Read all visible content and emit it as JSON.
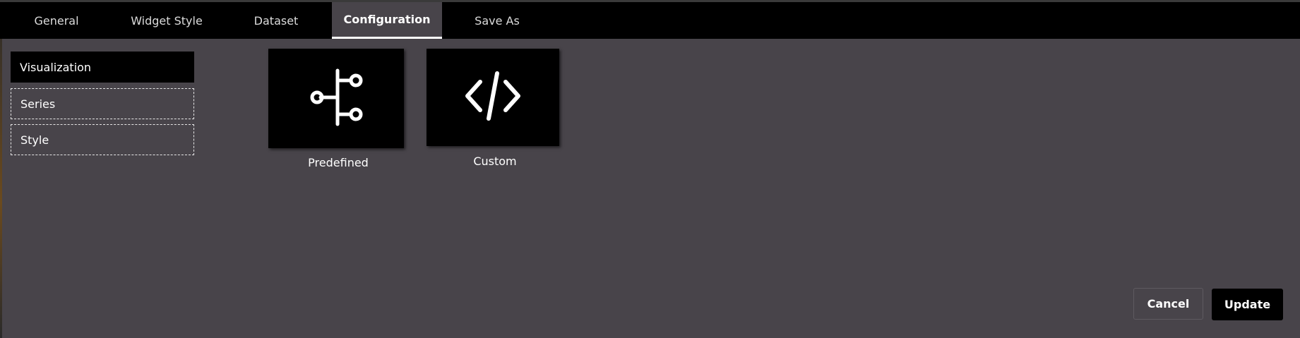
{
  "tabs": [
    {
      "label": "General"
    },
    {
      "label": "Widget Style"
    },
    {
      "label": "Dataset"
    },
    {
      "label": "Configuration",
      "active": true
    },
    {
      "label": "Save As"
    }
  ],
  "sidebar": {
    "items": [
      {
        "label": "Visualization",
        "active": true
      },
      {
        "label": "Series"
      },
      {
        "label": "Style"
      }
    ]
  },
  "options": [
    {
      "label": "Predefined",
      "icon": "branch-icon"
    },
    {
      "label": "Custom",
      "icon": "code-icon"
    }
  ],
  "footer": {
    "cancel_label": "Cancel",
    "update_label": "Update"
  },
  "colors": {
    "background": "#48444a",
    "tabbar": "#000000",
    "accent": "#ffffff"
  }
}
